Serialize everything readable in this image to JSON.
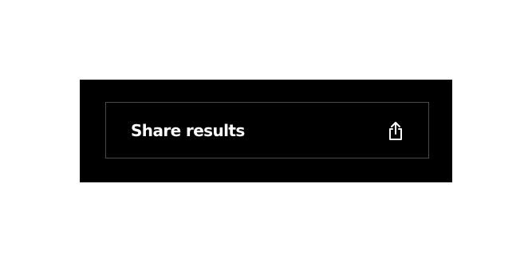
{
  "share": {
    "label": "Share results",
    "icon": "share-icon"
  },
  "colors": {
    "page_background": "#ffffff",
    "panel_background": "#000000",
    "row_border": "#4a4a4a",
    "text": "#ffffff"
  }
}
